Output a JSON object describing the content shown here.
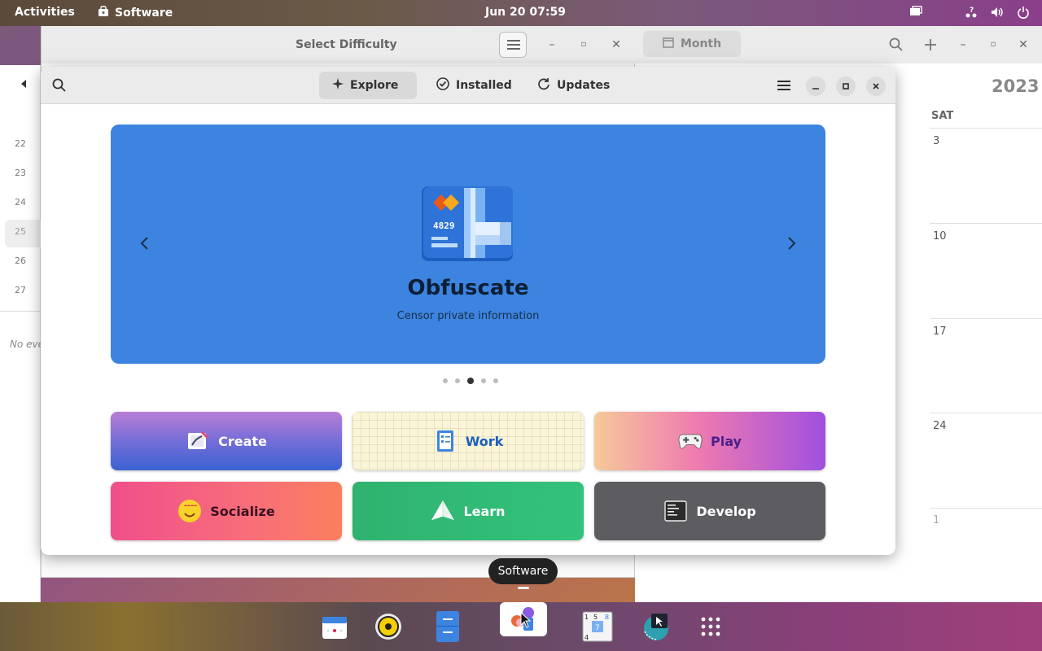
{
  "topbar": {
    "activities": "Activities",
    "app_name": "Software",
    "clock": "Jun 20  07:59"
  },
  "calendar": {
    "view_label": "Month",
    "year": "2023",
    "day_header": "SAT",
    "sat_dates": [
      "3",
      "10",
      "17",
      "24",
      "1"
    ],
    "week_numbers": [
      "22",
      "23",
      "24",
      "25",
      "26",
      "27"
    ],
    "no_events": "No eve"
  },
  "sudoku": {
    "title": "Select Difficulty"
  },
  "software": {
    "tabs": [
      {
        "label": "Explore",
        "active": true
      },
      {
        "label": "Installed",
        "active": false
      },
      {
        "label": "Updates",
        "active": false
      }
    ],
    "banner": {
      "app_name": "Obfuscate",
      "description": "Censor private information",
      "color": "#3c84e0",
      "page_count": 5,
      "active_page": 3
    },
    "categories": [
      {
        "label": "Create",
        "icon": "create-icon"
      },
      {
        "label": "Work",
        "icon": "work-icon"
      },
      {
        "label": "Play",
        "icon": "gamepad-icon"
      },
      {
        "label": "Socialize",
        "icon": "smiley-icon"
      },
      {
        "label": "Learn",
        "icon": "paper-plane-icon"
      },
      {
        "label": "Develop",
        "icon": "terminal-icon"
      }
    ]
  },
  "dock": {
    "tooltip": "Software",
    "items": [
      "calendar-app",
      "rhythmbox-app",
      "files-app",
      "software-app",
      "sudoku-app",
      "screenshot-app",
      "show-apps"
    ]
  }
}
